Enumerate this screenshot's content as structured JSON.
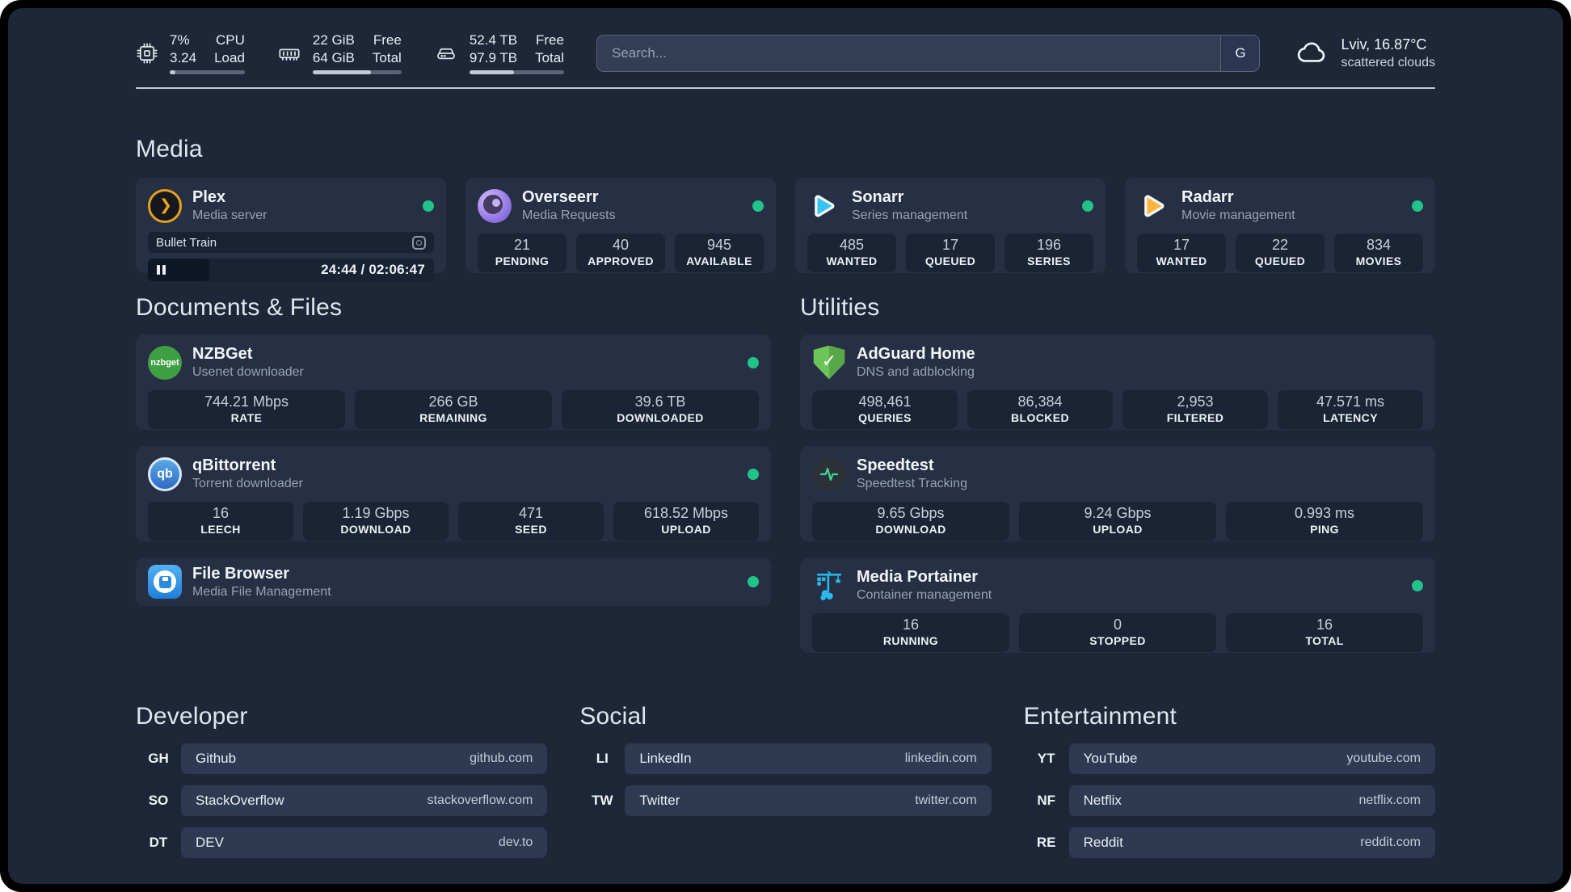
{
  "colors": {
    "background": "#1d2737",
    "card": "#262f44",
    "stat_box": "#1b2434",
    "online_green": "#21c38b",
    "plex_amber": "#e6a11c",
    "sonarr_blue": "#35c5f4",
    "radarr_amber": "#ffb53c",
    "nzbget_green": "#3f9f43",
    "qbittorrent_blue": "#2f6bc4",
    "filebrowser_blue": "#2a8ae0",
    "adguard_green": "#6dc457",
    "speedtest_green": "#3ed598",
    "portainer_cyan": "#29b8eb"
  },
  "header": {
    "stats": [
      {
        "icon": "cpu-icon",
        "value_top": "7%",
        "value_bottom": "3.24",
        "label_top": "CPU",
        "label_bottom": "Load",
        "progress": 8
      },
      {
        "icon": "ram-icon",
        "value_top": "22 GiB",
        "value_bottom": "64 GiB",
        "label_top": "Free",
        "label_bottom": "Total",
        "progress": 66
      },
      {
        "icon": "disk-icon",
        "value_top": "52.4 TB",
        "value_bottom": "97.9 TB",
        "label_top": "Free",
        "label_bottom": "Total",
        "progress": 47
      }
    ],
    "search": {
      "placeholder": "Search...",
      "engine_button": "G"
    },
    "weather": {
      "location_temp": "Lviv, 16.87°C",
      "condition": "scattered clouds"
    }
  },
  "sections": {
    "media": {
      "title": "Media",
      "plex": {
        "name": "Plex",
        "desc": "Media server",
        "now_playing": "Bullet Train",
        "time": "24:44 / 02:06:47"
      },
      "apps": [
        {
          "name": "Overseerr",
          "desc": "Media Requests",
          "stats": [
            {
              "value": "21",
              "label": "PENDING"
            },
            {
              "value": "40",
              "label": "APPROVED"
            },
            {
              "value": "945",
              "label": "AVAILABLE"
            }
          ]
        },
        {
          "name": "Sonarr",
          "desc": "Series management",
          "stats": [
            {
              "value": "485",
              "label": "WANTED"
            },
            {
              "value": "17",
              "label": "QUEUED"
            },
            {
              "value": "196",
              "label": "SERIES"
            }
          ]
        },
        {
          "name": "Radarr",
          "desc": "Movie management",
          "stats": [
            {
              "value": "17",
              "label": "WANTED"
            },
            {
              "value": "22",
              "label": "QUEUED"
            },
            {
              "value": "834",
              "label": "MOVIES"
            }
          ]
        }
      ]
    },
    "documents": {
      "title": "Documents & Files",
      "apps": [
        {
          "name": "NZBGet",
          "desc": "Usenet downloader",
          "icon_text": "nzbget",
          "stats": [
            {
              "value": "744.21 Mbps",
              "label": "RATE"
            },
            {
              "value": "266 GB",
              "label": "REMAINING"
            },
            {
              "value": "39.6 TB",
              "label": "DOWNLOADED"
            }
          ]
        },
        {
          "name": "qBittorrent",
          "desc": "Torrent downloader",
          "icon_text": "qb",
          "stats": [
            {
              "value": "16",
              "label": "LEECH"
            },
            {
              "value": "1.19 Gbps",
              "label": "DOWNLOAD"
            },
            {
              "value": "471",
              "label": "SEED"
            },
            {
              "value": "618.52 Mbps",
              "label": "UPLOAD"
            }
          ]
        },
        {
          "name": "File Browser",
          "desc": "Media File Management",
          "stats": []
        }
      ]
    },
    "utilities": {
      "title": "Utilities",
      "apps": [
        {
          "name": "AdGuard Home",
          "desc": "DNS and adblocking",
          "icon_text": "✓",
          "stats": [
            {
              "value": "498,461",
              "label": "QUERIES"
            },
            {
              "value": "86,384",
              "label": "BLOCKED"
            },
            {
              "value": "2,953",
              "label": "FILTERED"
            },
            {
              "value": "47.571 ms",
              "label": "LATENCY"
            }
          ]
        },
        {
          "name": "Speedtest",
          "desc": "Speedtest Tracking",
          "stats": [
            {
              "value": "9.65 Gbps",
              "label": "DOWNLOAD"
            },
            {
              "value": "9.24 Gbps",
              "label": "UPLOAD"
            },
            {
              "value": "0.993 ms",
              "label": "PING"
            }
          ]
        },
        {
          "name": "Media Portainer",
          "desc": "Container management",
          "stats": [
            {
              "value": "16",
              "label": "RUNNING"
            },
            {
              "value": "0",
              "label": "STOPPED"
            },
            {
              "value": "16",
              "label": "TOTAL"
            }
          ]
        }
      ]
    },
    "bookmarks": [
      {
        "title": "Developer",
        "links": [
          {
            "abbr": "GH",
            "name": "Github",
            "url": "github.com"
          },
          {
            "abbr": "SO",
            "name": "StackOverflow",
            "url": "stackoverflow.com"
          },
          {
            "abbr": "DT",
            "name": "DEV",
            "url": "dev.to"
          }
        ]
      },
      {
        "title": "Social",
        "links": [
          {
            "abbr": "LI",
            "name": "LinkedIn",
            "url": "linkedin.com"
          },
          {
            "abbr": "TW",
            "name": "Twitter",
            "url": "twitter.com"
          }
        ]
      },
      {
        "title": "Entertainment",
        "links": [
          {
            "abbr": "YT",
            "name": "YouTube",
            "url": "youtube.com"
          },
          {
            "abbr": "NF",
            "name": "Netflix",
            "url": "netflix.com"
          },
          {
            "abbr": "RE",
            "name": "Reddit",
            "url": "reddit.com"
          }
        ]
      }
    ]
  }
}
